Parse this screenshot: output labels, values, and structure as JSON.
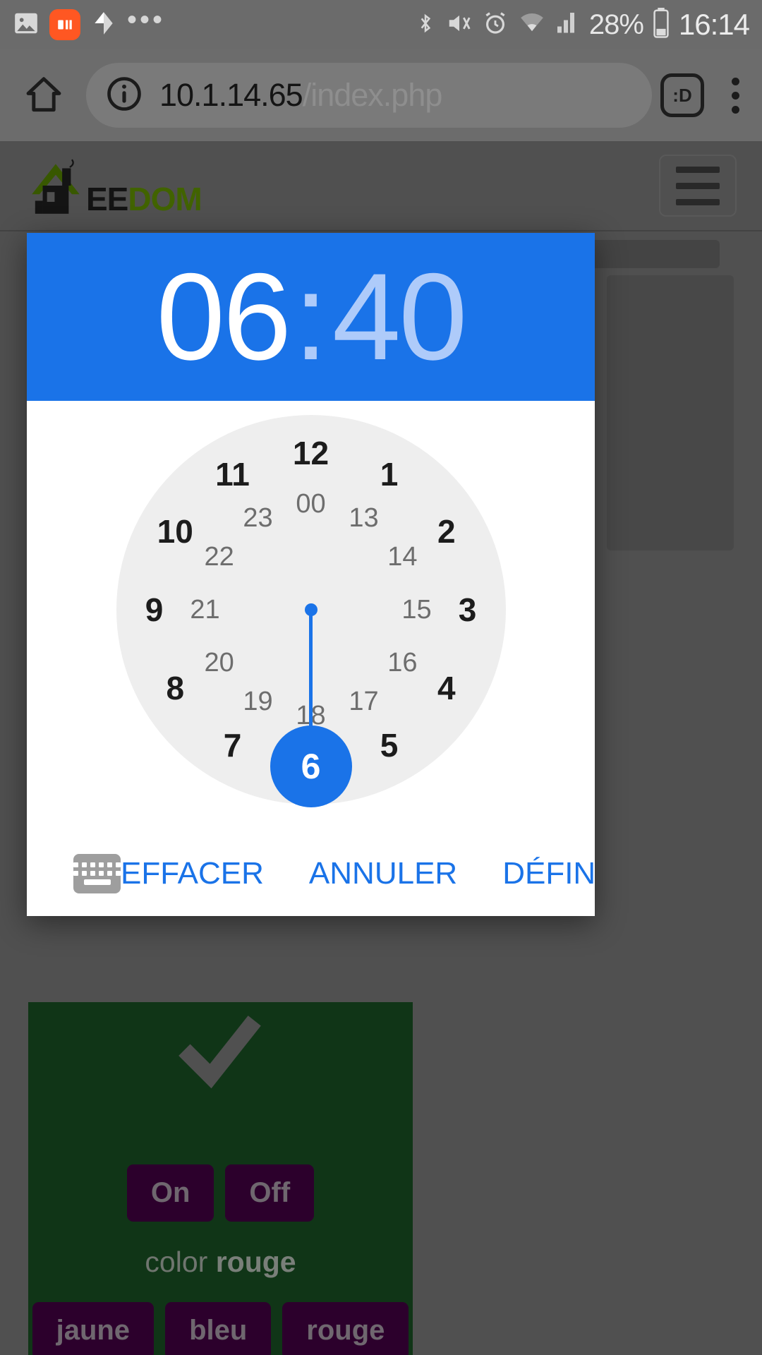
{
  "statusbar": {
    "left_icons": [
      "image-icon",
      "mi-app-icon",
      "location-icon",
      "more-notifications-icon"
    ],
    "mi_badge_label": "mi",
    "overflow_label": "•••",
    "right_icons": [
      "bluetooth-icon",
      "vibrate-mute-icon",
      "alarm-icon",
      "wifi-icon",
      "cellular-signal-icon",
      "battery-icon"
    ],
    "battery_percent": "28%",
    "clock": "16:14"
  },
  "browser": {
    "home_icon": "home-icon",
    "info_icon": "info-circle-icon",
    "url_host": "10.1.14.65",
    "url_path": "/index.php",
    "tab_count_label": ":D",
    "menu_icon": "kebab-menu-icon"
  },
  "site": {
    "logo_icon": "jeedom-house-logo",
    "logo_text_dark": "EE",
    "logo_text_green": "DOM",
    "logo_green_hex": "#5a8a00",
    "menu_button": "hamburger-menu-button"
  },
  "widget": {
    "panel_color_hex": "#174a21",
    "check_icon": "checkmark-icon",
    "power_buttons": [
      "On",
      "Off"
    ],
    "color_label_prefix": "color",
    "color_label_value": "rouge",
    "color_buttons": [
      "jaune",
      "bleu",
      "rouge"
    ],
    "button_color_hex": "#3e003e"
  },
  "timepicker": {
    "accent_hex": "#1a73e8",
    "hours": "06",
    "separator": ":",
    "minutes": "40",
    "selected_field": "hours",
    "selected_value": "6",
    "mode": "24h",
    "outer_ring": [
      "12",
      "1",
      "2",
      "3",
      "4",
      "5",
      "6",
      "7",
      "8",
      "9",
      "10",
      "11"
    ],
    "inner_ring": [
      "00",
      "13",
      "14",
      "15",
      "16",
      "17",
      "18",
      "19",
      "20",
      "21",
      "22",
      "23"
    ],
    "keyboard_toggle_icon": "keyboard-icon",
    "actions": {
      "clear": "EFFACER",
      "cancel": "ANNULER",
      "confirm": "DÉFINIR"
    }
  }
}
